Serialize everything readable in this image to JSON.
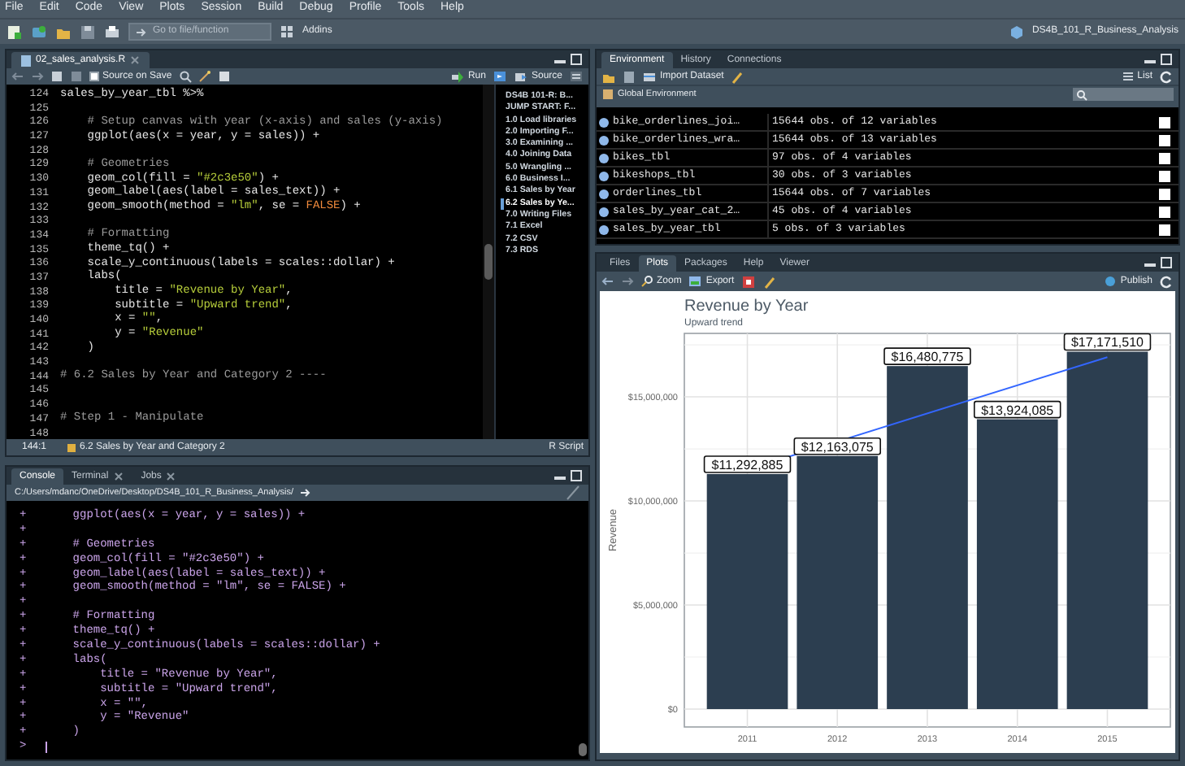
{
  "menu_bar": {
    "items": [
      "File",
      "Edit",
      "Code",
      "View",
      "Plots",
      "Session",
      "Build",
      "Debug",
      "Profile",
      "Tools",
      "Help"
    ]
  },
  "toolbar": {
    "goto_placeholder": "Go to file/function",
    "addins": "Addins",
    "project": "DS4B_101_R_Business_Analysis"
  },
  "editor": {
    "tabs": [
      {
        "label": "02_sales_analysis.R",
        "selected": true
      }
    ],
    "toolbar": {
      "source_on_save": {
        "label": "Source on Save",
        "checked": false
      },
      "run": "Run",
      "source": "Source"
    },
    "lines": [
      {
        "number": "124",
        "segments": [
          {
            "kind": "code",
            "text": "sales_by_year_tbl %>%"
          }
        ]
      },
      {
        "number": "125"
      },
      {
        "number": "126",
        "segments": [
          {
            "kind": "comment",
            "text": "    # Setup canvas with year (x-axis) and sales (y-axis)"
          }
        ]
      },
      {
        "number": "127",
        "segments": [
          {
            "kind": "code",
            "text": "    ggplot(aes(x = year, y = sales)) +"
          }
        ]
      },
      {
        "number": "128"
      },
      {
        "number": "129",
        "segments": [
          {
            "kind": "comment",
            "text": "    # Geometries"
          }
        ]
      },
      {
        "number": "130",
        "segments": [
          {
            "kind": "code",
            "text": "    geom_col(fill = "
          },
          {
            "kind": "string",
            "text": "\"#2c3e50\""
          },
          {
            "kind": "code",
            "text": ") +"
          }
        ]
      },
      {
        "number": "131",
        "segments": [
          {
            "kind": "code",
            "text": "    geom_label(aes(label = sales_text)) +"
          }
        ]
      },
      {
        "number": "132",
        "segments": [
          {
            "kind": "code",
            "text": "    geom_smooth(method = "
          },
          {
            "kind": "string",
            "text": "\"lm\""
          },
          {
            "kind": "code",
            "text": ", se = "
          },
          {
            "kind": "constant",
            "text": "FALSE"
          },
          {
            "kind": "code",
            "text": ") +"
          }
        ]
      },
      {
        "number": "133"
      },
      {
        "number": "134",
        "segments": [
          {
            "kind": "comment",
            "text": "    # Formatting"
          }
        ]
      },
      {
        "number": "135",
        "segments": [
          {
            "kind": "code",
            "text": "    theme_tq() +"
          }
        ]
      },
      {
        "number": "136",
        "segments": [
          {
            "kind": "code",
            "text": "    scale_y_continuous(labels = scales::dollar) +"
          }
        ]
      },
      {
        "number": "137",
        "segments": [
          {
            "kind": "code",
            "text": "    labs("
          }
        ]
      },
      {
        "number": "138",
        "segments": [
          {
            "kind": "code",
            "text": "        title = "
          },
          {
            "kind": "string",
            "text": "\"Revenue by Year\""
          },
          {
            "kind": "code",
            "text": ","
          }
        ]
      },
      {
        "number": "139",
        "segments": [
          {
            "kind": "code",
            "text": "        subtitle = "
          },
          {
            "kind": "string",
            "text": "\"Upward trend\""
          },
          {
            "kind": "code",
            "text": ","
          }
        ]
      },
      {
        "number": "140",
        "segments": [
          {
            "kind": "code",
            "text": "        x = "
          },
          {
            "kind": "string",
            "text": "\"\""
          },
          {
            "kind": "code",
            "text": ","
          }
        ]
      },
      {
        "number": "141",
        "segments": [
          {
            "kind": "code",
            "text": "        y = "
          },
          {
            "kind": "string",
            "text": "\"Revenue\""
          }
        ]
      },
      {
        "number": "142",
        "segments": [
          {
            "kind": "code",
            "text": "    )"
          }
        ]
      },
      {
        "number": "143"
      },
      {
        "number": "144",
        "segments": [
          {
            "kind": "comment",
            "text": "# 6.2 Sales by Year and Category 2 ----"
          }
        ]
      },
      {
        "number": "145"
      },
      {
        "number": "146"
      },
      {
        "number": "147",
        "segments": [
          {
            "kind": "comment",
            "text": "# Step 1 - Manipulate"
          }
        ]
      },
      {
        "number": "148"
      }
    ],
    "outline": [
      {
        "label": "DS4B 101-R: B...",
        "selected": false
      },
      {
        "label": "JUMP START: F...",
        "selected": false
      },
      {
        "label": "1.0 Load libraries",
        "selected": false
      },
      {
        "label": "2.0 Importing F...",
        "selected": false
      },
      {
        "label": "3.0 Examining ...",
        "selected": false
      },
      {
        "label": "4.0 Joining Data",
        "selected": false
      },
      {
        "label": "5.0 Wrangling ...",
        "selected": false
      },
      {
        "label": "6.0 Business I...",
        "selected": false
      },
      {
        "label": "6.1 Sales by Year",
        "selected": false
      },
      {
        "label": "6.2 Sales by Ye...",
        "selected": true
      },
      {
        "label": "7.0 Writing Files",
        "selected": false
      },
      {
        "label": "7.1 Excel",
        "selected": false
      },
      {
        "label": "7.2 CSV",
        "selected": false
      },
      {
        "label": "7.3 RDS",
        "selected": false
      }
    ],
    "status_bar": {
      "position": "144:1",
      "section": "6.2 Sales by Year and Category 2",
      "file_type": "R Script"
    }
  },
  "console": {
    "tabs": [
      {
        "label": "Console",
        "selected": true
      },
      {
        "label": "Terminal",
        "selected": false
      },
      {
        "label": "Jobs",
        "selected": false
      }
    ],
    "path": "C:/Users/mdanc/OneDrive/Desktop/DS4B_101_R_Business_Analysis/",
    "lines": [
      {
        "prompt": "+",
        "text": "    ggplot(aes(x = year, y = sales)) +"
      },
      {
        "prompt": "+"
      },
      {
        "prompt": "+",
        "text": "    # Geometries"
      },
      {
        "prompt": "+",
        "text": "    geom_col(fill = \"#2c3e50\") +"
      },
      {
        "prompt": "+",
        "text": "    geom_label(aes(label = sales_text)) +"
      },
      {
        "prompt": "+",
        "text": "    geom_smooth(method = \"lm\", se = FALSE) +"
      },
      {
        "prompt": "+"
      },
      {
        "prompt": "+",
        "text": "    # Formatting"
      },
      {
        "prompt": "+",
        "text": "    theme_tq() +"
      },
      {
        "prompt": "+",
        "text": "    scale_y_continuous(labels = scales::dollar) +"
      },
      {
        "prompt": "+",
        "text": "    labs("
      },
      {
        "prompt": "+",
        "text": "        title = \"Revenue by Year\","
      },
      {
        "prompt": "+",
        "text": "        subtitle = \"Upward trend\","
      },
      {
        "prompt": "+",
        "text": "        x = \"\","
      },
      {
        "prompt": "+",
        "text": "        y = \"Revenue\""
      },
      {
        "prompt": "+",
        "text": "    )"
      },
      {
        "prompt": ">"
      }
    ]
  },
  "environment": {
    "tabs": [
      {
        "label": "Environment",
        "selected": true
      },
      {
        "label": "History",
        "selected": false
      },
      {
        "label": "Connections",
        "selected": false
      }
    ],
    "toolbar": {
      "import": "Import Dataset",
      "view": "List"
    },
    "scope": "Global Environment",
    "rows": [
      {
        "name": "bike_orderlines_joi…",
        "value": "15644 obs. of 12 variables"
      },
      {
        "name": "bike_orderlines_wra…",
        "value": "15644 obs. of 13 variables"
      },
      {
        "name": "bikes_tbl",
        "value": "97 obs. of 4 variables"
      },
      {
        "name": "bikeshops_tbl",
        "value": "30 obs. of 3 variables"
      },
      {
        "name": "orderlines_tbl",
        "value": "15644 obs. of 7 variables"
      },
      {
        "name": "sales_by_year_cat_2…",
        "value": "45 obs. of 4 variables"
      },
      {
        "name": "sales_by_year_tbl",
        "value": "5 obs. of 3 variables"
      }
    ]
  },
  "plots": {
    "tabs": [
      {
        "label": "Files",
        "selected": false
      },
      {
        "label": "Plots",
        "selected": true
      },
      {
        "label": "Packages",
        "selected": false
      },
      {
        "label": "Help",
        "selected": false
      },
      {
        "label": "Viewer",
        "selected": false
      }
    ],
    "toolbar": {
      "zoom": "Zoom",
      "export": "Export",
      "publish": "Publish"
    },
    "subtitle": "Upward trend",
    "chart_data": {
      "type": "bar",
      "title": "Revenue by Year",
      "ylabel": "Revenue",
      "categories": [
        "2011",
        "2012",
        "2013",
        "2014",
        "2015"
      ],
      "series": [
        {
          "color": "#2c3e50",
          "values": [
            11292885,
            12163075,
            16480775,
            13924085,
            17171510
          ]
        }
      ],
      "grid": true,
      "ylim": [
        -860000,
        18050000
      ],
      "yticks": [
        {
          "value": 0,
          "label": "$0"
        },
        {
          "value": 5000000,
          "label": "$5,000,000"
        },
        {
          "value": 10000000,
          "label": "$10,000,000"
        },
        {
          "value": 15000000,
          "label": "$15,000,000"
        }
      ],
      "value_labels": [
        "$11,292,885",
        "$12,163,075",
        "$16,480,775",
        "$13,924,085",
        "$17,171,510"
      ]
    },
    "trend_line": {
      "color": "#3366ff"
    }
  }
}
